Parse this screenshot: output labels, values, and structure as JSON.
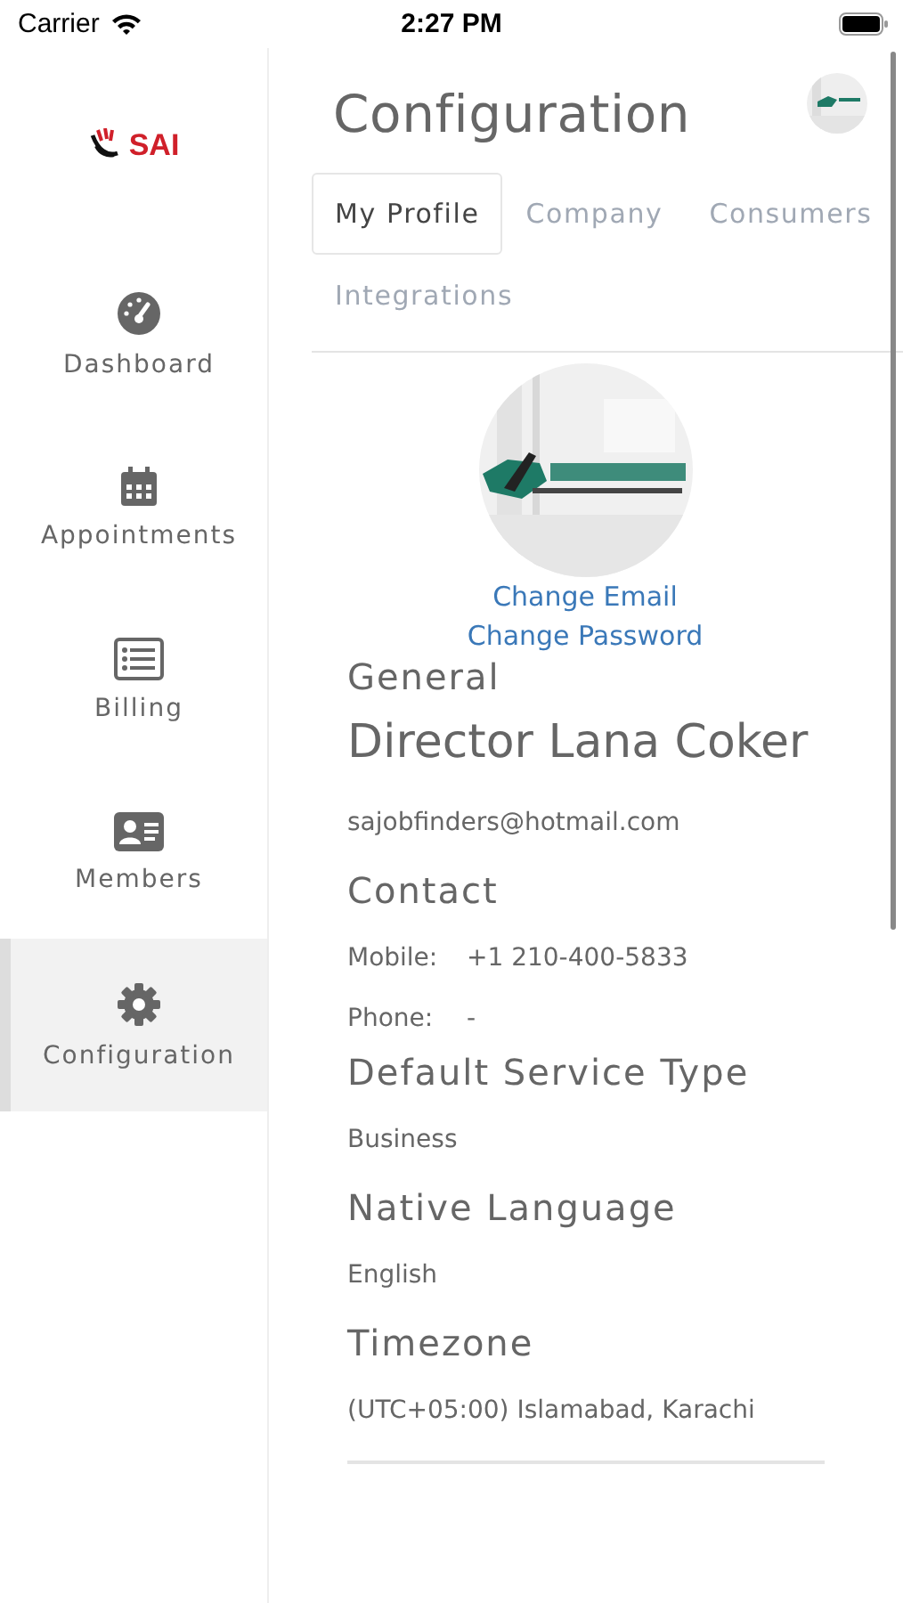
{
  "status_bar": {
    "carrier": "Carrier",
    "time": "2:27 PM"
  },
  "logo": {
    "text": "SAI"
  },
  "sidebar": {
    "items": [
      {
        "label": "Dashboard",
        "selected": false
      },
      {
        "label": "Appointments",
        "selected": false
      },
      {
        "label": "Billing",
        "selected": false
      },
      {
        "label": "Members",
        "selected": false
      },
      {
        "label": "Configuration",
        "selected": true
      }
    ]
  },
  "page": {
    "title": "Configuration"
  },
  "tabs": [
    {
      "label": "My Profile",
      "selected": true
    },
    {
      "label": "Company",
      "selected": false
    },
    {
      "label": "Consumers",
      "selected": false
    },
    {
      "label": "Integrations",
      "selected": false
    }
  ],
  "profile": {
    "links": [
      "Change Email",
      "Change Password"
    ],
    "rows": [
      {
        "kind": "heading",
        "text": "General"
      },
      {
        "kind": "name",
        "text": "Director Lana Coker"
      },
      {
        "kind": "text",
        "text": "sajobfinders@hotmail.com"
      },
      {
        "kind": "heading",
        "text": "Contact"
      },
      {
        "kind": "field",
        "label": "Mobile:",
        "value": "+1 210-400-5833"
      },
      {
        "kind": "field",
        "label": "Phone:",
        "value": "-"
      },
      {
        "kind": "heading",
        "text": "Default Service Type"
      },
      {
        "kind": "text",
        "text": "Business"
      },
      {
        "kind": "heading",
        "text": "Native Language"
      },
      {
        "kind": "text",
        "text": "English"
      },
      {
        "kind": "heading",
        "text": "Timezone"
      },
      {
        "kind": "text",
        "text": "(UTC+05:00) Islamabad, Karachi"
      }
    ]
  }
}
